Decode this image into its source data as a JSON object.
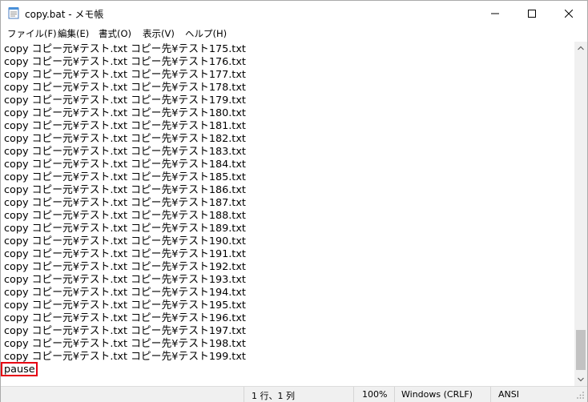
{
  "window": {
    "title": "copy.bat - メモ帳",
    "minimize_label": "minimize",
    "maximize_label": "maximize",
    "close_label": "close"
  },
  "menu": [
    {
      "label": "ファイル(F)"
    },
    {
      "label": "編集(E)"
    },
    {
      "label": "書式(O)"
    },
    {
      "label": "表示(V)"
    },
    {
      "label": "ヘルプ(H)"
    }
  ],
  "editor": {
    "lines": [
      "copy コピー元¥テスト.txt コピー先¥テスト175.txt",
      "copy コピー元¥テスト.txt コピー先¥テスト176.txt",
      "copy コピー元¥テスト.txt コピー先¥テスト177.txt",
      "copy コピー元¥テスト.txt コピー先¥テスト178.txt",
      "copy コピー元¥テスト.txt コピー先¥テスト179.txt",
      "copy コピー元¥テスト.txt コピー先¥テスト180.txt",
      "copy コピー元¥テスト.txt コピー先¥テスト181.txt",
      "copy コピー元¥テスト.txt コピー先¥テスト182.txt",
      "copy コピー元¥テスト.txt コピー先¥テスト183.txt",
      "copy コピー元¥テスト.txt コピー先¥テスト184.txt",
      "copy コピー元¥テスト.txt コピー先¥テスト185.txt",
      "copy コピー元¥テスト.txt コピー先¥テスト186.txt",
      "copy コピー元¥テスト.txt コピー先¥テスト187.txt",
      "copy コピー元¥テスト.txt コピー先¥テスト188.txt",
      "copy コピー元¥テスト.txt コピー先¥テスト189.txt",
      "copy コピー元¥テスト.txt コピー先¥テスト190.txt",
      "copy コピー元¥テスト.txt コピー先¥テスト191.txt",
      "copy コピー元¥テスト.txt コピー先¥テスト192.txt",
      "copy コピー元¥テスト.txt コピー先¥テスト193.txt",
      "copy コピー元¥テスト.txt コピー先¥テスト194.txt",
      "copy コピー元¥テスト.txt コピー先¥テスト195.txt",
      "copy コピー元¥テスト.txt コピー先¥テスト196.txt",
      "copy コピー元¥テスト.txt コピー先¥テスト197.txt",
      "copy コピー元¥テスト.txt コピー先¥テスト198.txt",
      "copy コピー元¥テスト.txt コピー先¥テスト199.txt",
      "pause"
    ]
  },
  "status": {
    "position": "1 行、1 列",
    "zoom": "100%",
    "line_ending": "Windows (CRLF)",
    "encoding": "ANSI"
  },
  "colors": {
    "highlight": "#e60012",
    "scroll_thumb": "#c2c2c2"
  }
}
